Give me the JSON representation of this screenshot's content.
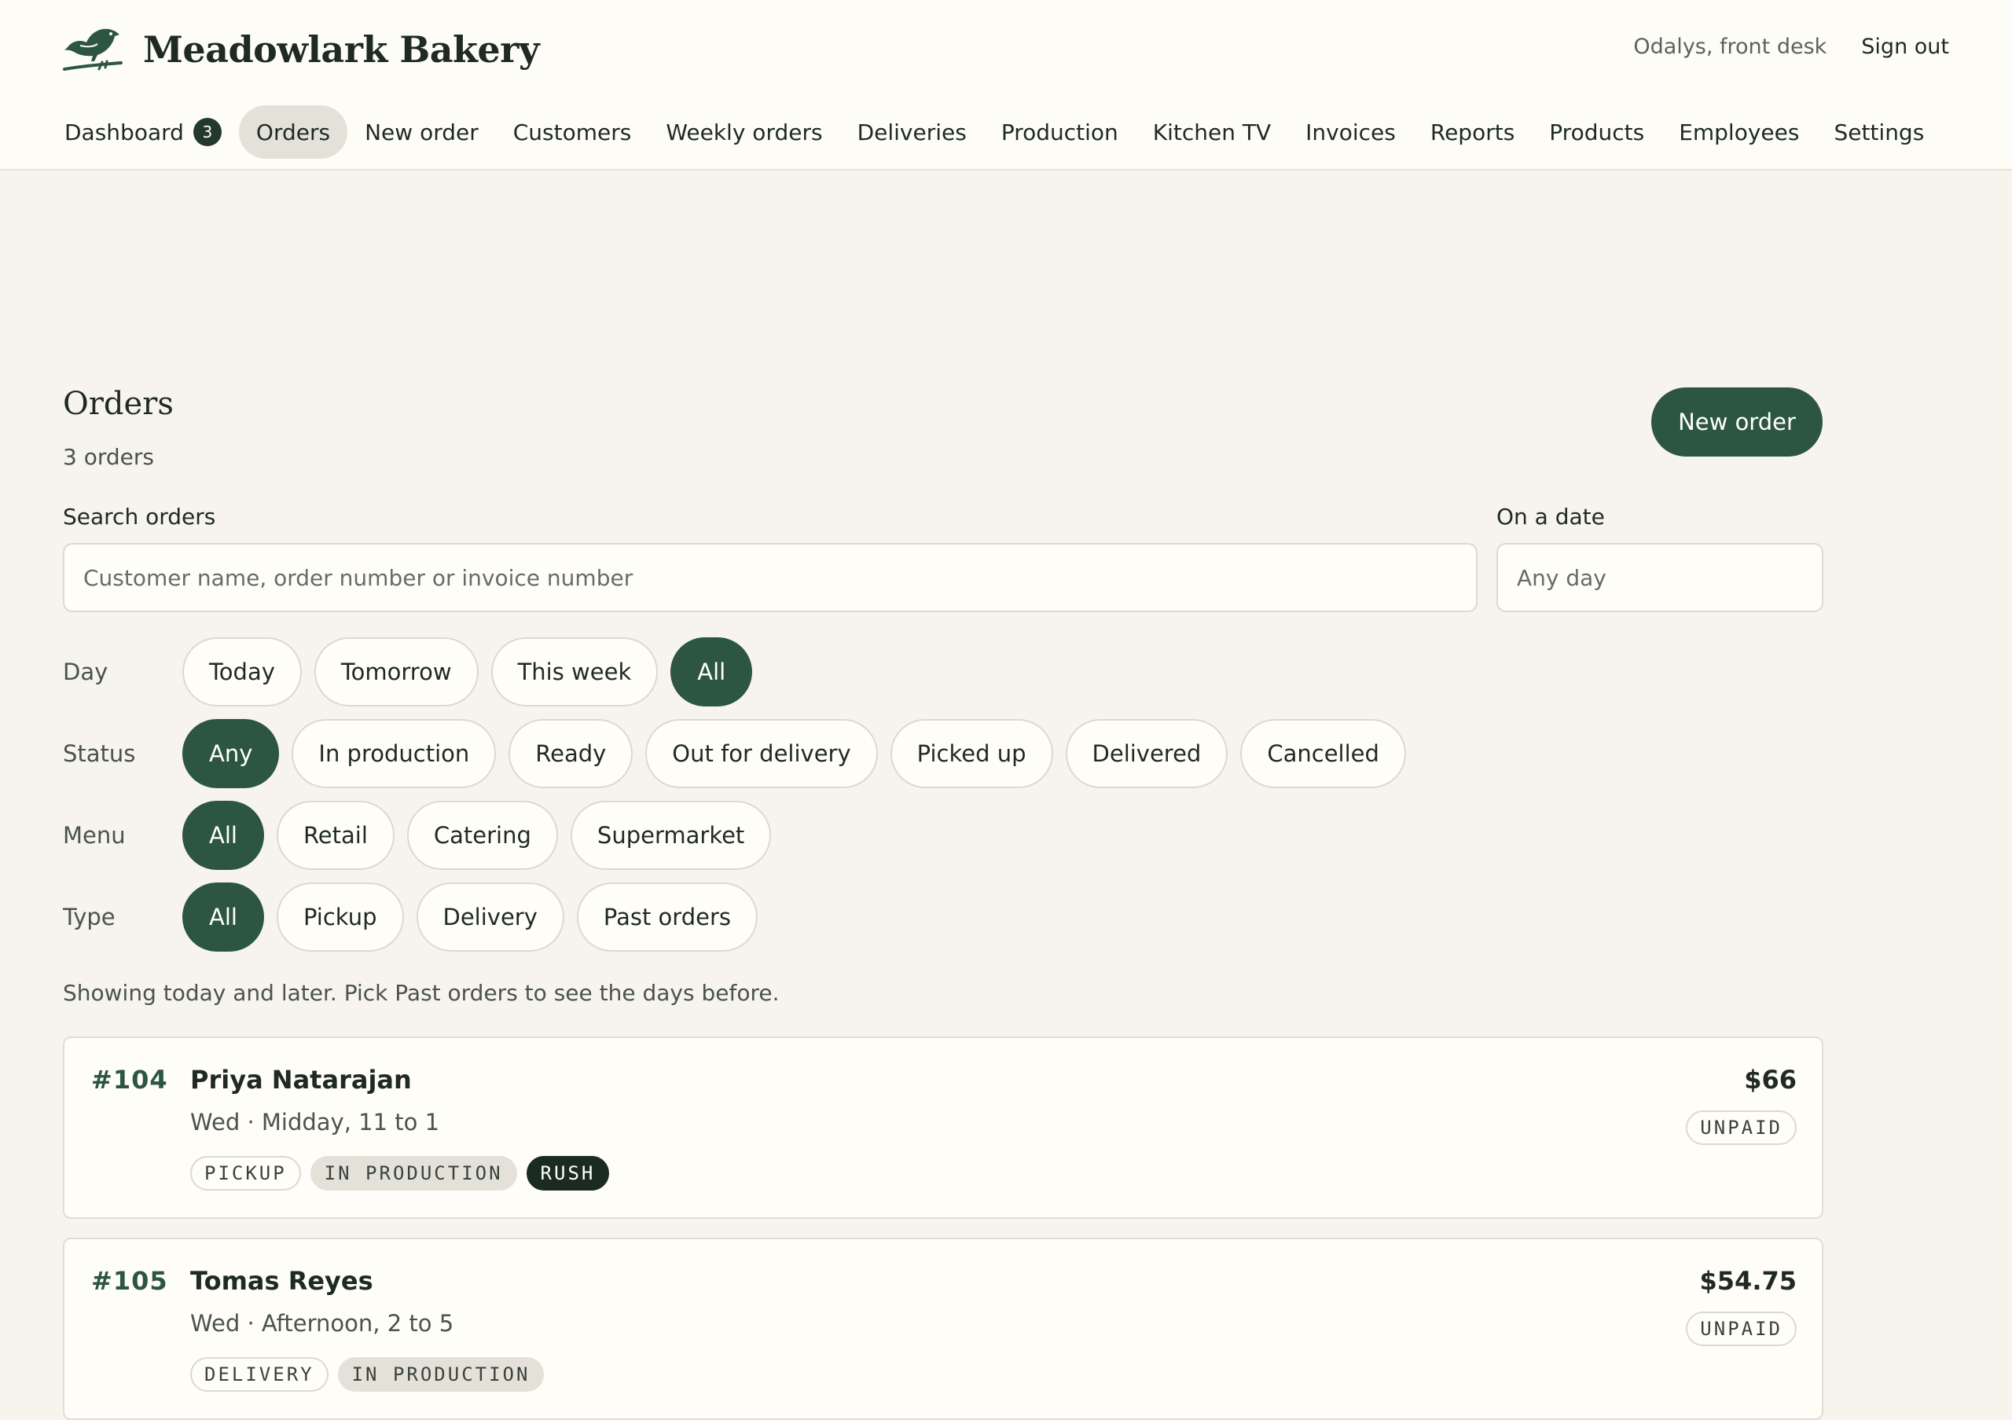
{
  "header": {
    "brand_name": "Meadowlark Bakery",
    "user_label": "Odalys, front desk",
    "signout_label": "Sign out"
  },
  "nav": [
    {
      "label": "Dashboard",
      "badge": "3"
    },
    {
      "label": "Orders",
      "active": true
    },
    {
      "label": "New order"
    },
    {
      "label": "Customers"
    },
    {
      "label": "Weekly orders"
    },
    {
      "label": "Deliveries"
    },
    {
      "label": "Production"
    },
    {
      "label": "Kitchen TV"
    },
    {
      "label": "Invoices"
    },
    {
      "label": "Reports"
    },
    {
      "label": "Products"
    },
    {
      "label": "Employees"
    },
    {
      "label": "Settings"
    }
  ],
  "page": {
    "title": "Orders",
    "count_text": "3 orders",
    "new_order_label": "New order"
  },
  "search": {
    "label": "Search orders",
    "placeholder": "Customer name, order number or invoice number"
  },
  "date": {
    "label": "On a date",
    "placeholder": "Any day"
  },
  "filters": {
    "day": {
      "label": "Day",
      "options": [
        "Today",
        "Tomorrow",
        "This week",
        "All"
      ],
      "selected": "All"
    },
    "status": {
      "label": "Status",
      "options": [
        "Any",
        "In production",
        "Ready",
        "Out for delivery",
        "Picked up",
        "Delivered",
        "Cancelled"
      ],
      "selected": "Any"
    },
    "menu": {
      "label": "Menu",
      "options": [
        "All",
        "Retail",
        "Catering",
        "Supermarket"
      ],
      "selected": "All"
    },
    "type": {
      "label": "Type",
      "options": [
        "All",
        "Pickup",
        "Delivery",
        "Past orders"
      ],
      "selected": "All"
    }
  },
  "hint": "Showing today and later. Pick Past orders to see the days before.",
  "orders": [
    {
      "number": "#104",
      "customer": "Priya Natarajan",
      "slot": "Wed · Midday, 11 to 1",
      "tags": [
        "PICKUP",
        "IN PRODUCTION",
        "RUSH"
      ],
      "total": "$66",
      "payment": "UNPAID"
    },
    {
      "number": "#105",
      "customer": "Tomas Reyes",
      "slot": "Wed · Afternoon, 2 to 5",
      "tags": [
        "DELIVERY",
        "IN PRODUCTION"
      ],
      "total": "$54.75",
      "payment": "UNPAID"
    }
  ],
  "icons": {
    "logo": "meadowlark-bird-icon"
  },
  "colors": {
    "accent": "#2d5640",
    "background": "#f6f4ec",
    "surface": "#fffdf8",
    "rush": "#1c2b22"
  }
}
